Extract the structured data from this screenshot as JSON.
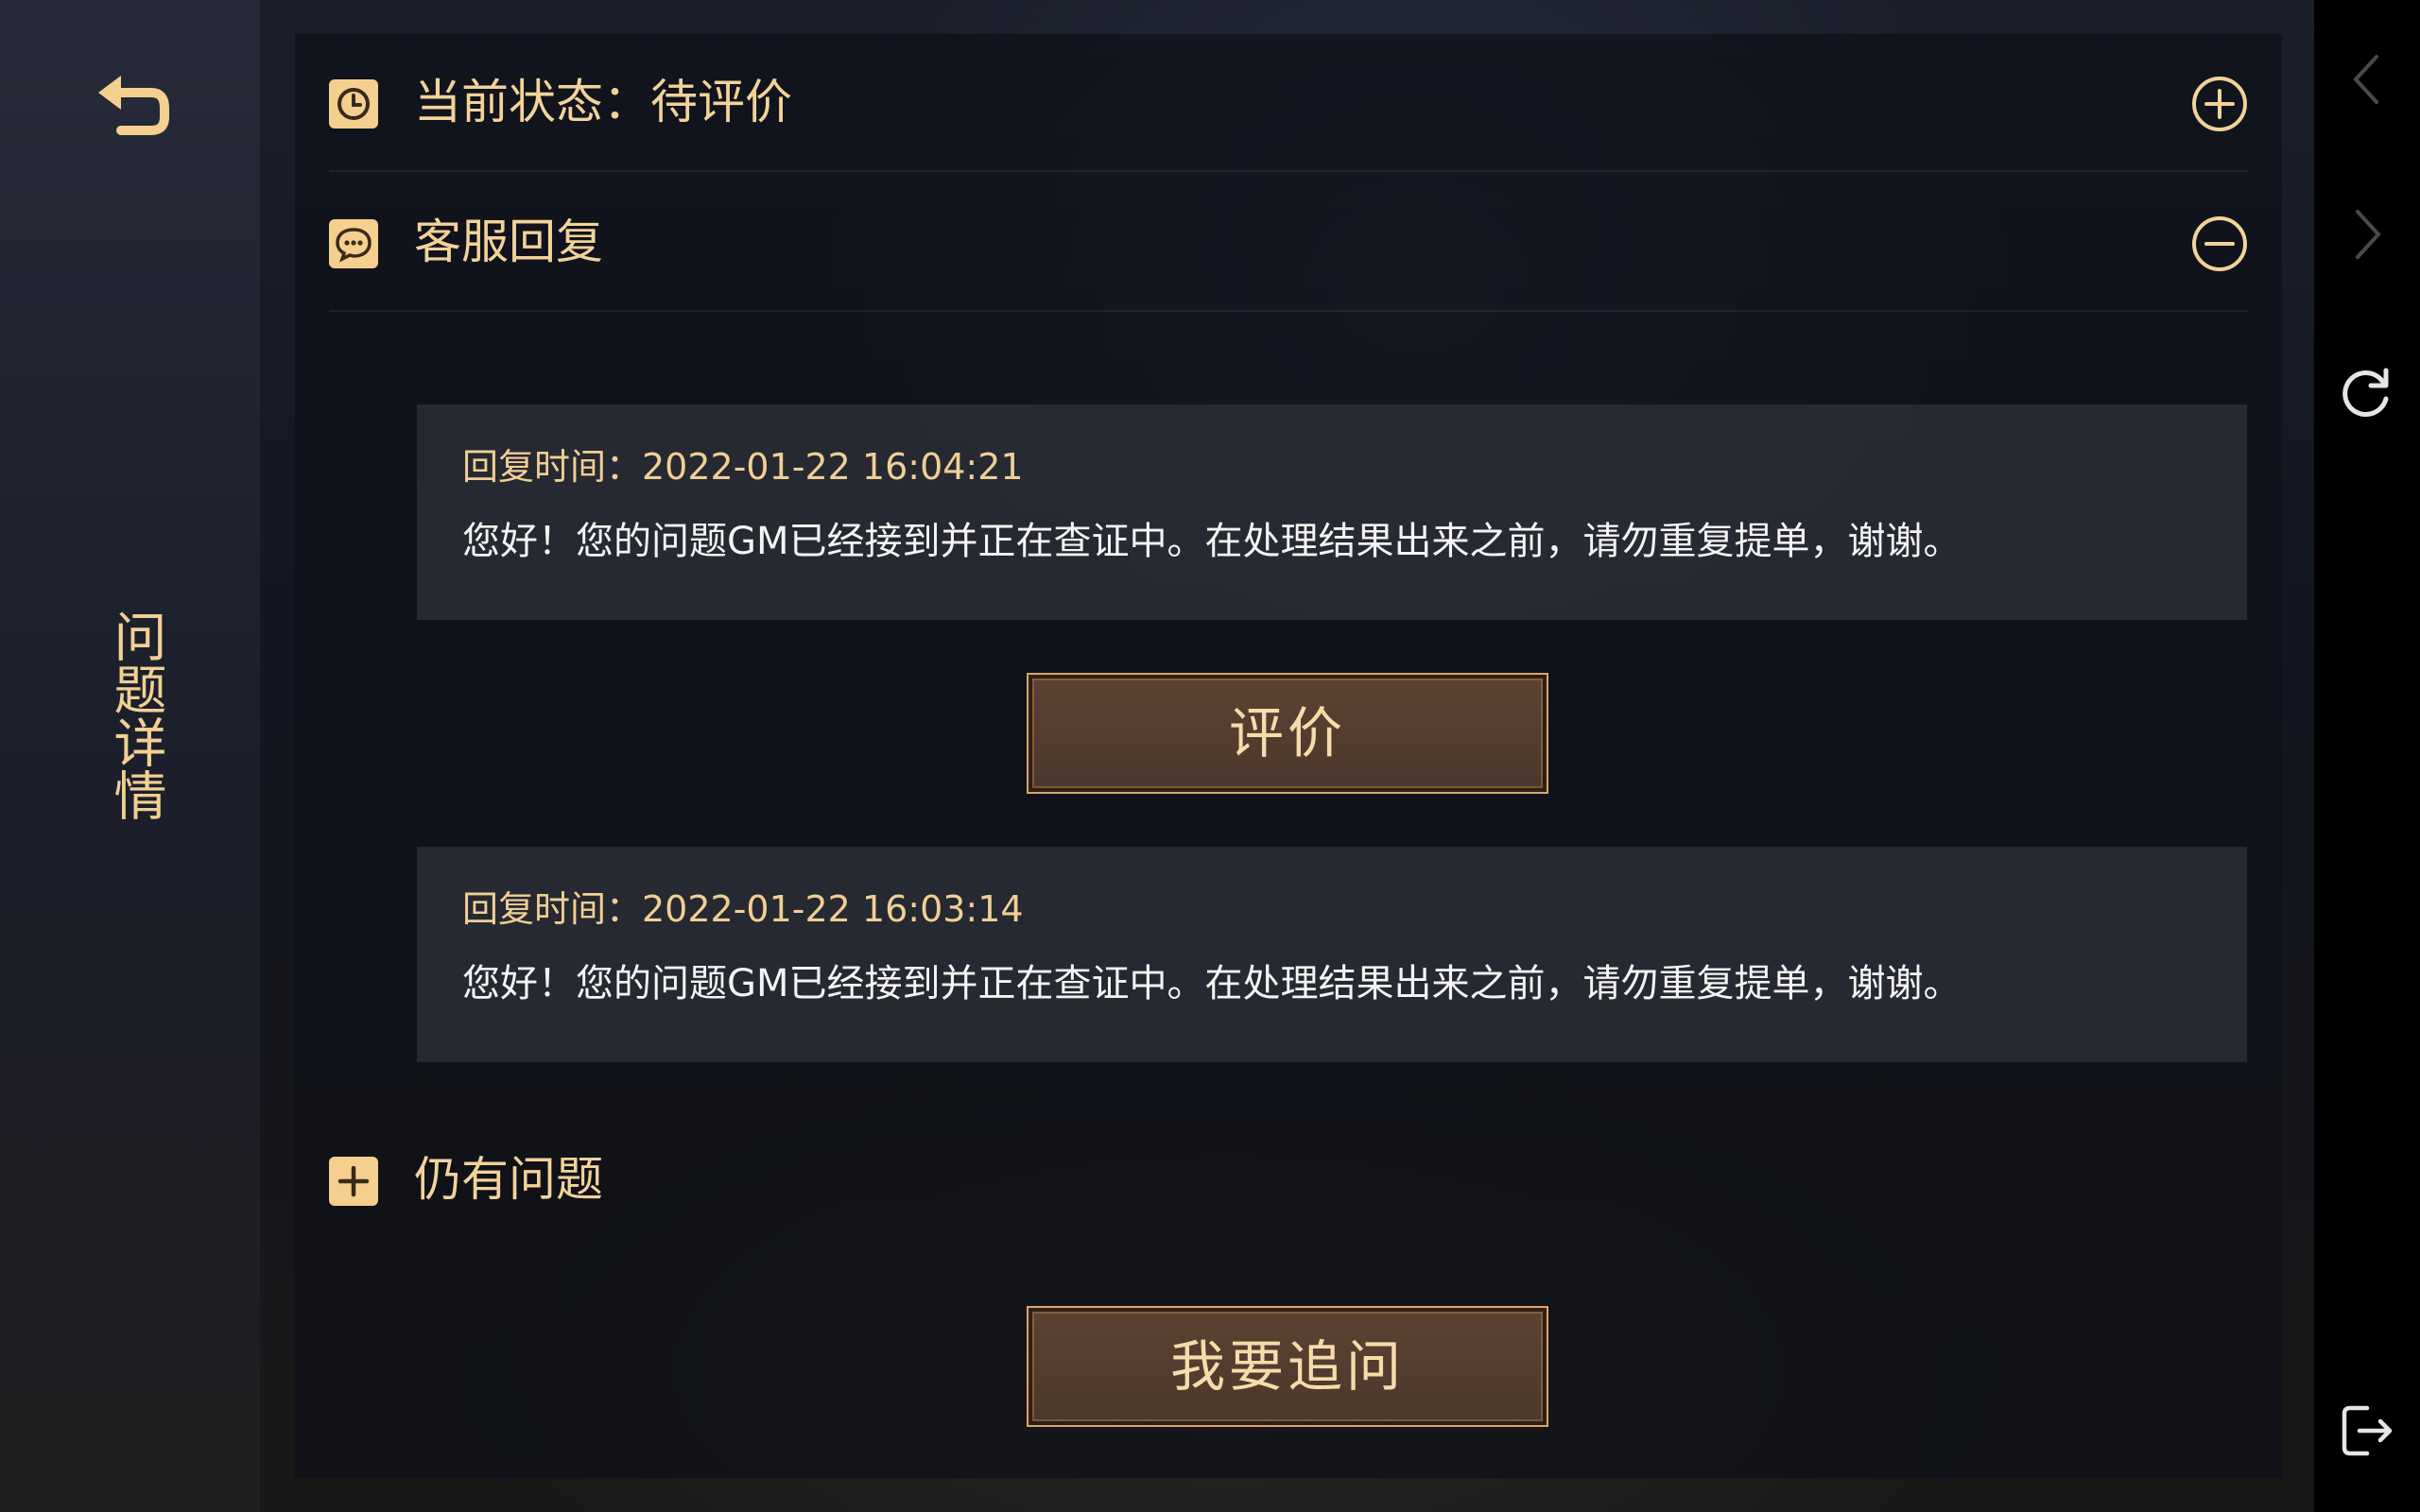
{
  "sidebar": {
    "back_icon": "back-arrow-icon",
    "title": "问题详情"
  },
  "status_row": {
    "icon": "clock-icon",
    "label": "当前状态：待评价",
    "toggle_icon": "plus-circle-icon"
  },
  "reply_section": {
    "icon": "chat-bubble-icon",
    "label": "客服回复",
    "toggle_icon": "minus-circle-icon",
    "replies": [
      {
        "time": "回复时间：2022-01-22 16:04:21",
        "text": "您好！您的问题GM已经接到并正在查证中。在处理结果出来之前，请勿重复提单，谢谢。"
      },
      {
        "time": "回复时间：2022-01-22 16:03:14",
        "text": "您好！您的问题GM已经接到并正在查证中。在处理结果出来之前，请勿重复提单，谢谢。"
      }
    ],
    "rate_button": "评价"
  },
  "still_issue": {
    "icon": "plus-square-icon",
    "label": "仍有问题",
    "followup_button": "我要追问"
  },
  "rail": {
    "back_icon": "chevron-left-icon",
    "forward_icon": "chevron-right-icon",
    "refresh_icon": "refresh-icon",
    "exit_icon": "exit-icon"
  },
  "colors": {
    "accent": "#f3d29a",
    "button_border": "#d9a66a",
    "button_fill": "#52392c"
  }
}
